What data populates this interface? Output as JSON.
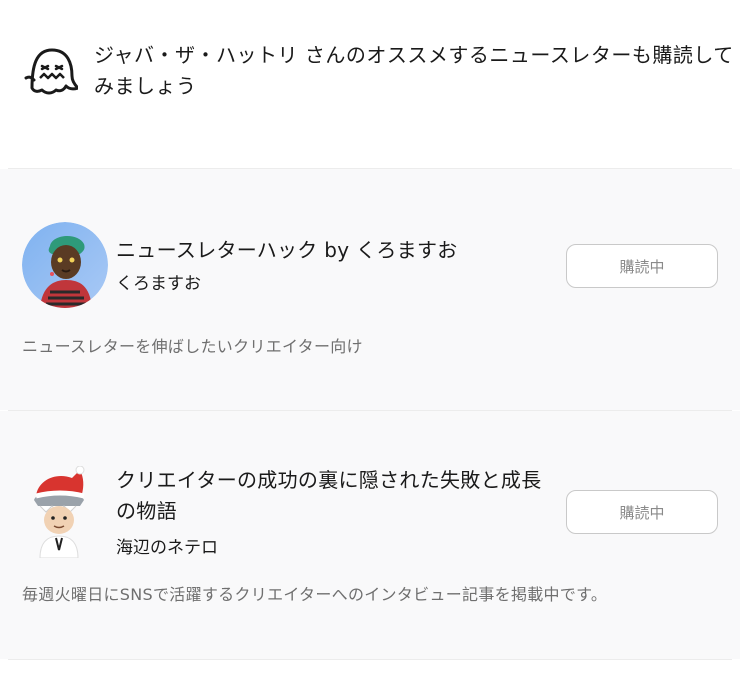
{
  "recommendation": {
    "icon": "ghost-icon",
    "heading": "ジャバ・ザ・ハットリ さんのオススメするニュースレターも購読してみましょう"
  },
  "newsletters": [
    {
      "title": "ニュースレターハック by くろますお",
      "author": "くろますお",
      "button_label": "購読中",
      "description": "ニュースレターを伸ばしたいクリエイター向け",
      "avatar": "author-avatar-kuromasuo"
    },
    {
      "title": "クリエイターの成功の裏に隠された失敗と成長の物語",
      "author": "海辺のネテロ",
      "button_label": "購読中",
      "description": "毎週火曜日にSNSで活躍するクリエイターへのインタビュー記事を掲載中です。",
      "avatar": "author-avatar-umibe-no-netero"
    }
  ],
  "colors": {
    "card_background": "#f9f9fa",
    "divider": "#ececec",
    "button_border": "#c9c9c9",
    "button_text": "#8a8a8a",
    "description_text": "#6f6f6f"
  }
}
